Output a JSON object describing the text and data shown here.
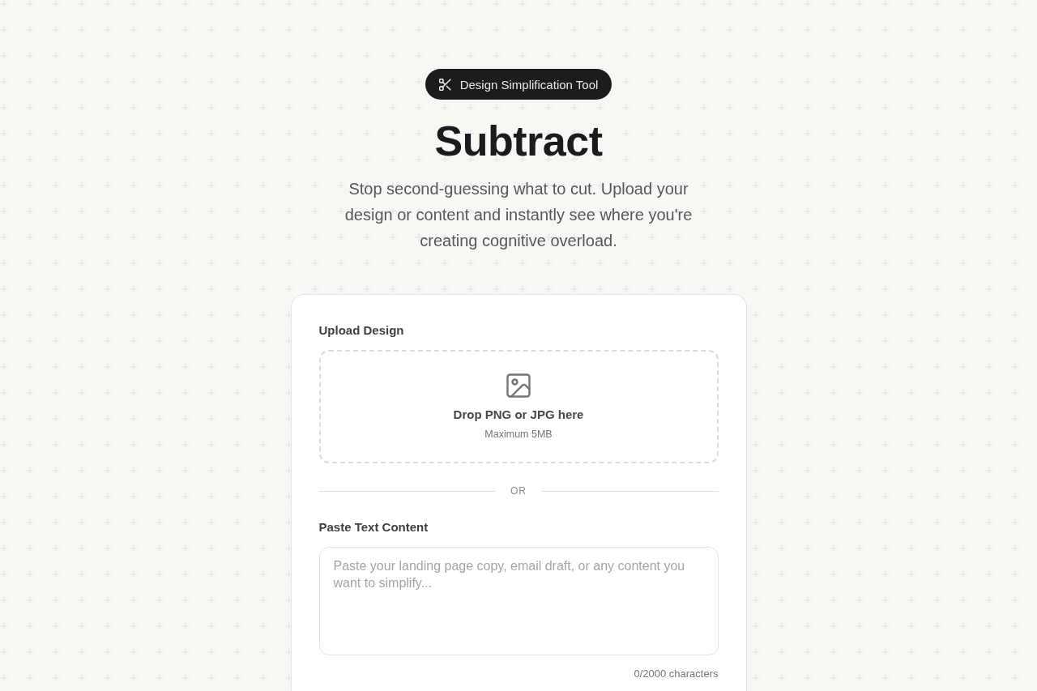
{
  "badge": {
    "label": "Design Simplification Tool"
  },
  "hero": {
    "title": "Subtract",
    "subtitle": "Stop second-guessing what to cut. Upload your design or content and instantly see where you're creating cognitive overload."
  },
  "upload": {
    "label": "Upload Design",
    "dropzone": {
      "title": "Drop PNG or JPG here",
      "hint": "Maximum 5MB"
    }
  },
  "divider": {
    "label": "OR"
  },
  "text_input": {
    "label": "Paste Text Content",
    "placeholder": "Paste your landing page copy, email draft, or any content you want to simplify...",
    "counter": "0/2000 characters"
  }
}
